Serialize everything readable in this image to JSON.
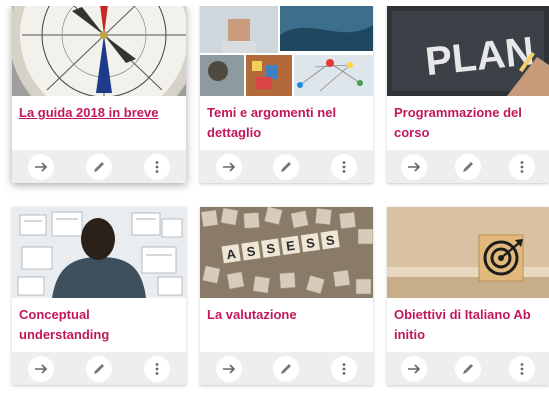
{
  "theme": {
    "title_color": "#c2185b",
    "action_bar_bg": "#eeeeee",
    "icon_color": "#666666"
  },
  "cards": [
    {
      "title": "La guida 2018 in breve",
      "image": "compass-image",
      "active": true
    },
    {
      "title": "Temi e argomenti nel dettaglio",
      "image": "collage-image",
      "active": false
    },
    {
      "title": "Programmazione del corso",
      "image": "plan-chalkboard-image",
      "active": false
    },
    {
      "title": "Conceptual understanding",
      "image": "man-at-whiteboard-image",
      "active": false
    },
    {
      "title": "La valutazione",
      "image": "assess-tiles-image",
      "active": false
    },
    {
      "title": "Obiettivi di Italiano Ab initio",
      "image": "target-block-image",
      "active": false
    }
  ],
  "actions": [
    {
      "name": "open-arrow-icon"
    },
    {
      "name": "pencil-icon"
    },
    {
      "name": "more-vertical-icon"
    }
  ]
}
